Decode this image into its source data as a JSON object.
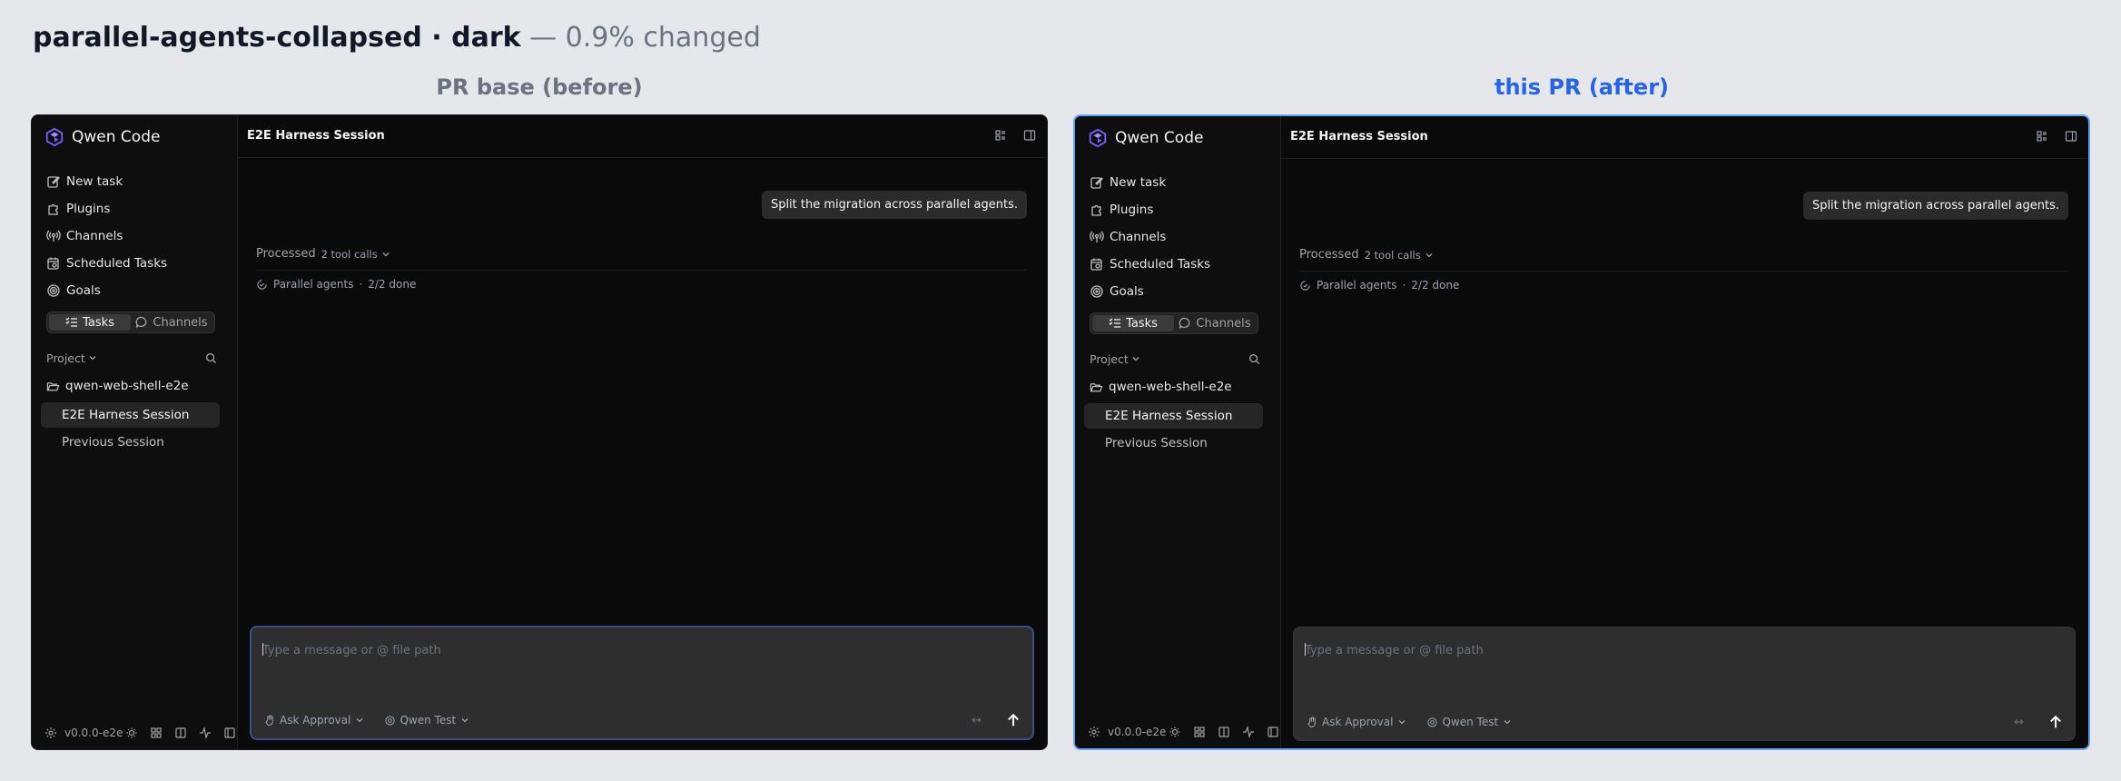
{
  "header": {
    "title_bold": "parallel-agents-collapsed · dark",
    "title_rest": " — 0.9% changed"
  },
  "labels": {
    "before": "PR base (before)",
    "after": "this PR (after)"
  },
  "colors": {
    "before_label": "#6b7280",
    "after_label": "#2563eb",
    "app_bg": "#0a0a0a",
    "brand_purple": "#7c5cff"
  },
  "app": {
    "brand": "Qwen Code",
    "nav": [
      {
        "label": "New task",
        "icon": "edit-icon"
      },
      {
        "label": "Plugins",
        "icon": "puzzle-icon"
      },
      {
        "label": "Channels",
        "icon": "broadcast-icon"
      },
      {
        "label": "Scheduled Tasks",
        "icon": "calendar-clock-icon"
      },
      {
        "label": "Goals",
        "icon": "target-icon"
      }
    ],
    "segment": {
      "tasks": "Tasks",
      "channels": "Channels",
      "active": "Tasks"
    },
    "project": {
      "label": "Project"
    },
    "folder": "qwen-web-shell-e2e",
    "sessions": {
      "active": "E2E Harness Session",
      "inactive": "Previous Session"
    },
    "footer": {
      "version": "v0.0.0-e2e"
    },
    "topbar": {
      "title": "E2E Harness Session"
    },
    "chat": {
      "user_message": "Split the migration across parallel agents.",
      "processed_label": "Processed",
      "processed_count": "2 tool calls",
      "agents_label": "Parallel agents",
      "agents_sep": "·",
      "agents_status": "2/2 done"
    },
    "composer": {
      "placeholder": "Type a message or @ file path",
      "approval": "Ask Approval",
      "model": "Qwen Test",
      "expand": "↔"
    }
  }
}
